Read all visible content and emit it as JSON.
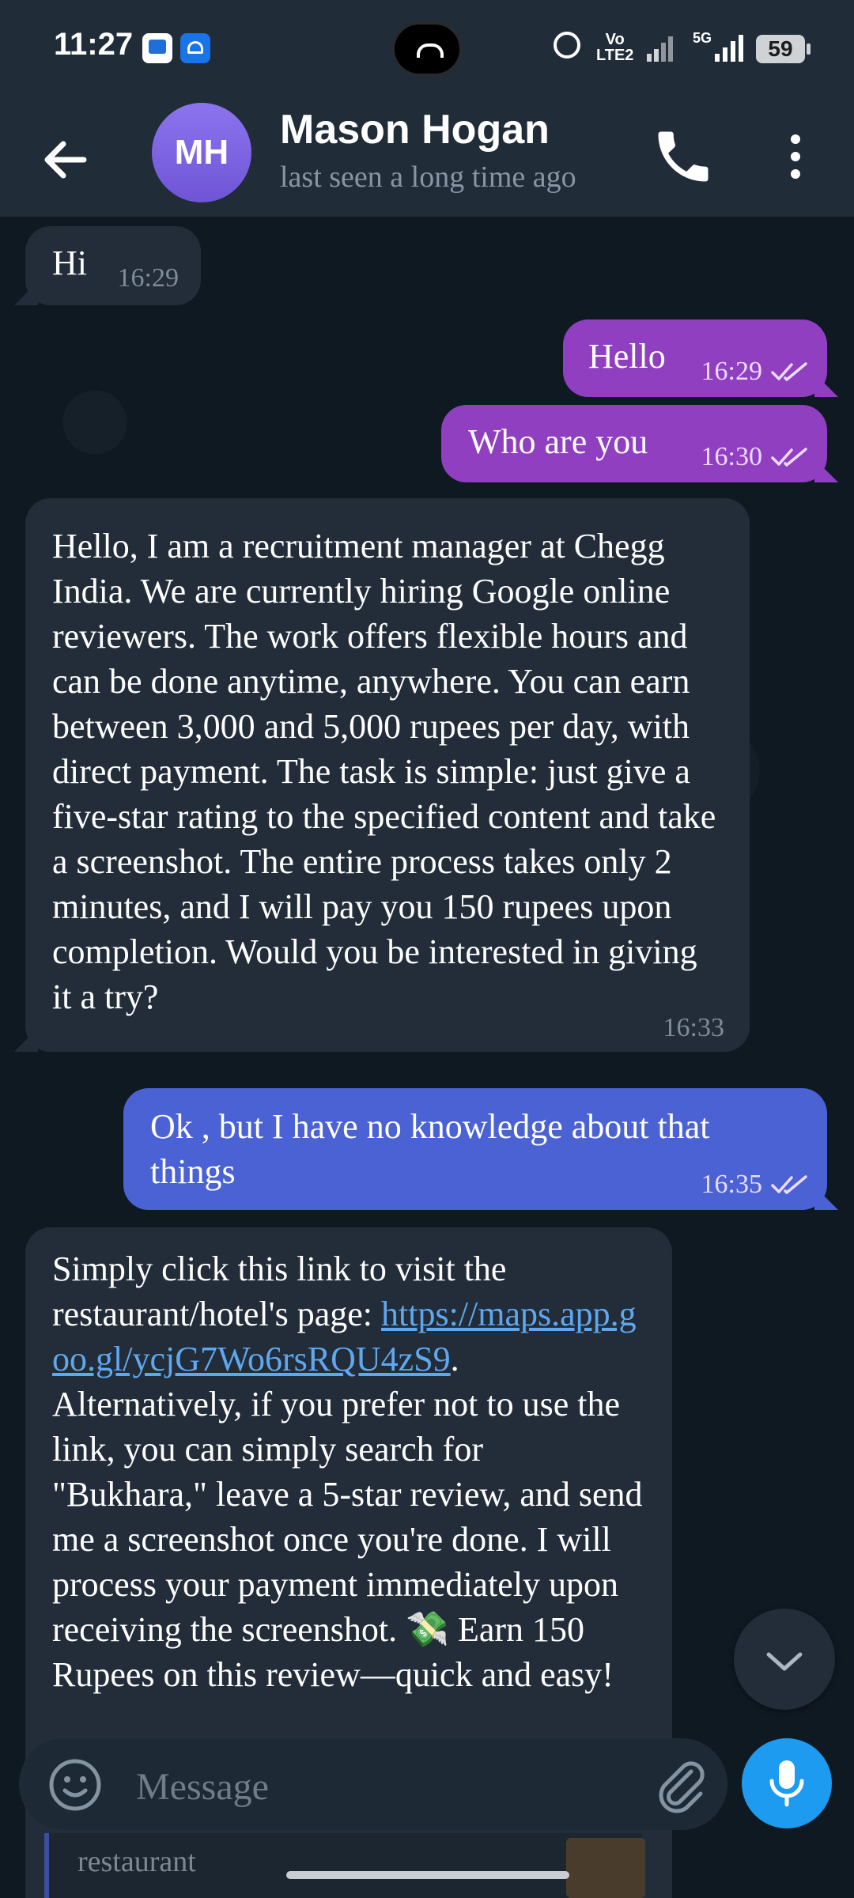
{
  "status_bar": {
    "time": "11:27",
    "network": "Vo\nLTE2",
    "fivg": "5G",
    "battery": "59"
  },
  "header": {
    "avatar_initials": "MH",
    "contact_name": "Mason Hogan",
    "last_seen": "last seen a long time ago"
  },
  "messages": [
    {
      "direction": "in",
      "text": "Hi",
      "time": "16:29"
    },
    {
      "direction": "out",
      "text": "Hello",
      "time": "16:29",
      "read": true
    },
    {
      "direction": "out",
      "text": "Who are you",
      "time": "16:30",
      "read": true
    },
    {
      "direction": "in",
      "text": "Hello, I am a recruitment manager at Chegg India. We are currently hiring Google online reviewers. The work offers flexible hours and can be done anytime, anywhere. You can earn between 3,000 and 5,000 rupees per day, with direct payment. The task is simple: just give a five-star rating to the specified content and take a screenshot. The entire process takes only 2 minutes, and I will pay you 150 rupees upon completion. Would you be interested in giving it a try?",
      "time": "16:33"
    },
    {
      "direction": "out",
      "text": "Ok , but I have no knowledge about that things",
      "time": "16:35",
      "read": true
    },
    {
      "direction": "in",
      "text_before": "Simply click this link to visit the restaurant/hotel's page: ",
      "link": "https://maps.app.goo.gl/ycjG7Wo6rsRQU4zS9",
      "text_after": ". Alternatively, if you prefer not to use the link, you can simply search for \"Bukhara,\" leave a 5-star review, and send me a screenshot once you're done. I will process your payment immediately upon receiving the screenshot. 💸 Earn 150 Rupees on this review—quick and easy!"
    }
  ],
  "link_preview": {
    "text": "restaurant"
  },
  "input": {
    "placeholder": "Message"
  },
  "colors": {
    "background": "#0f1922",
    "incoming_bubble": "#222d39",
    "outgoing_bubble_purple": "#8f3fc0",
    "outgoing_bubble_blue": "#4a62d4",
    "accent": "#1c9bf0",
    "avatar": "#7b62e0"
  },
  "icons": {
    "back": "arrow-left-icon",
    "call": "phone-icon",
    "more": "vertical-dots-icon",
    "scroll_down": "chevron-down-icon",
    "emoji": "smiley-icon",
    "attach": "paperclip-icon",
    "mic": "microphone-icon",
    "read_receipt": "double-check-icon"
  }
}
